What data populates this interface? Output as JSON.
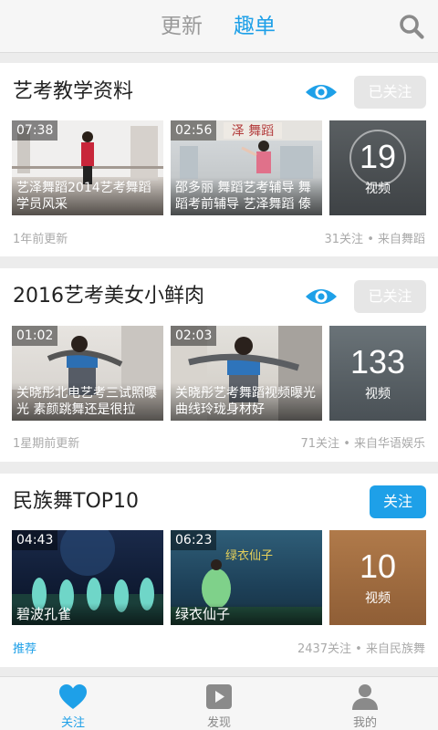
{
  "header": {
    "tabs": [
      {
        "label": "更新",
        "active": false
      },
      {
        "label": "趣单",
        "active": true
      }
    ],
    "accent_color": "#1ea0e8"
  },
  "cards": [
    {
      "title": "艺考教学资料",
      "follow_label": "已关注",
      "videos": [
        {
          "duration": "07:38",
          "caption": "艺泽舞蹈2014艺考舞蹈学员风采"
        },
        {
          "duration": "02:56",
          "caption": "邵多丽 舞蹈艺考辅导 舞蹈考前辅导 艺泽舞蹈 傣"
        }
      ],
      "video_count": "19",
      "video_count_label": "视频",
      "updated": "1年前更新",
      "source": "31关注 • 来自舞蹈"
    },
    {
      "title": "2016艺考美女小鲜肉",
      "follow_label": "已关注",
      "videos": [
        {
          "duration": "01:02",
          "caption": "关晓彤北电艺考三试照曝光 素颜跳舞还是很拉"
        },
        {
          "duration": "02:03",
          "caption": "关晓彤艺考舞蹈视频曝光 曲线玲珑身材好"
        }
      ],
      "video_count": "133",
      "video_count_label": "视频",
      "updated": "1星期前更新",
      "source": "71关注 • 来自华语娱乐"
    },
    {
      "title": "民族舞TOP10",
      "follow_label": "关注",
      "videos": [
        {
          "duration": "04:43",
          "caption": "碧波孔雀"
        },
        {
          "duration": "06:23",
          "caption": "绿衣仙子"
        }
      ],
      "video_count": "10",
      "video_count_label": "视频",
      "updated": "推荐",
      "source": "2437关注 • 来自民族舞"
    }
  ],
  "bottom_nav": [
    {
      "label": "关注",
      "icon": "heart-icon",
      "active": true
    },
    {
      "label": "发现",
      "icon": "play-icon",
      "active": false
    },
    {
      "label": "我的",
      "icon": "person-icon",
      "active": false
    }
  ]
}
